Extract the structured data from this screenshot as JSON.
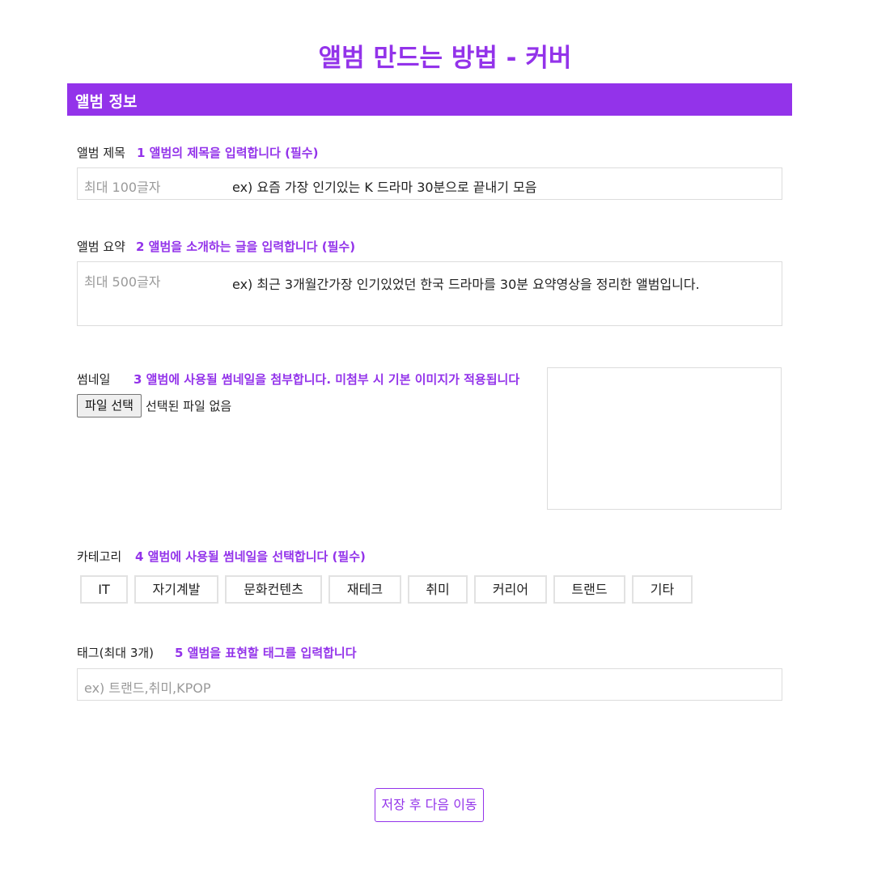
{
  "page": {
    "title": "앨범 만드는 방법 - 커버"
  },
  "section": {
    "title": "앨범 정보"
  },
  "album_title": {
    "label": "앨범 제목",
    "hint": "1 앨범의 제목을 입력합니다 (필수)",
    "placeholder": "최대 100글자",
    "example": "ex) 요즘 가장 인기있는 K 드라마 30분으로 끝내기 모음"
  },
  "album_summary": {
    "label": "앨범 요약",
    "hint": "2 앨범을 소개하는 글을 입력합니다 (필수)",
    "placeholder": "최대 500글자",
    "example": "ex) 최근 3개월간가장 인기있었던 한국 드라마를 30분 요약영상을 정리한 앨범입니다."
  },
  "thumbnail": {
    "label": "썸네일",
    "hint": "3 앨범에 사용될 썸네일을 첨부합니다. 미첨부 시 기본 이미지가 적용됩니다",
    "file_button": "파일 선택",
    "file_status": "선택된 파일 없음"
  },
  "category": {
    "label": "카테고리",
    "hint": "4 앨범에 사용될 썸네일을 선택합니다 (필수)",
    "options": [
      "IT",
      "자기계발",
      "문화컨텐츠",
      "재테크",
      "취미",
      "커리어",
      "트랜드",
      "기타"
    ]
  },
  "tags": {
    "label": "태그(최대 3개)",
    "hint": "5 앨범을 표현할 태그를 입력합니다",
    "placeholder": "ex) 트랜드,취미,KPOP"
  },
  "actions": {
    "save_label": "저장 후 다음 이동"
  },
  "colors": {
    "accent": "#9333ea",
    "border": "#dcdcdc"
  }
}
